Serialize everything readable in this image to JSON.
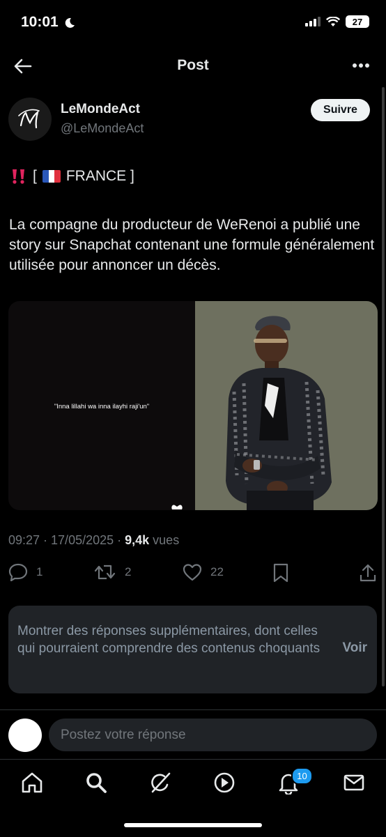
{
  "status_bar": {
    "time": "10:01",
    "battery": "27"
  },
  "header": {
    "title": "Post"
  },
  "post": {
    "author": {
      "display_name": "LeMondeAct",
      "handle": "@LeMondeAct"
    },
    "follow_label": "Suivre",
    "tag_open": "[",
    "tag_country": "FRANCE ]",
    "text": "La compagne du producteur de WeRenoi a publié une story sur Snapchat contenant une formule généralement utilisée pour annoncer un décès.",
    "media": {
      "caption": "\"Inna lillahi wa inna ilayhi raji'un\""
    },
    "timestamp": "09:27 · 17/05/2025 · ",
    "views_count": "9,4k",
    "views_label": " vues",
    "stats": {
      "replies": "1",
      "reposts": "2",
      "likes": "22"
    }
  },
  "sensitive": {
    "text": "Montrer des réponses supplémentaires, dont celles qui pourraient comprendre des contenus choquants",
    "button": "Voir"
  },
  "reply": {
    "placeholder": "Postez votre réponse"
  },
  "nav": {
    "notifications_badge": "10"
  },
  "colors": {
    "accent": "#1d9bf0",
    "muted": "#71767b",
    "surface": "#202327"
  }
}
